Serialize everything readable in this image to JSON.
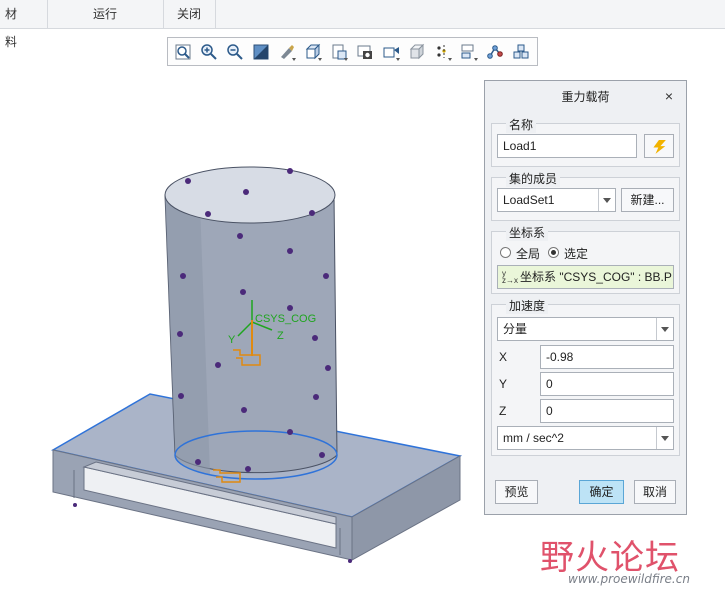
{
  "menubar": {
    "items": [
      {
        "label": "材料"
      },
      {
        "label": "运行"
      },
      {
        "label": "关闭"
      }
    ]
  },
  "toolbar": {
    "icons": [
      "zoom-fit-icon",
      "zoom-in-icon",
      "zoom-out-icon",
      "shade-style-icon",
      "repaint-icon",
      "saved-view-icon",
      "view-manager-icon",
      "display-style-icon",
      "spin-center-icon",
      "datum-display-icon",
      "annotation-display-icon",
      "layer-icon",
      "simulation-display-icon",
      "hide-icon"
    ]
  },
  "model": {
    "csys_label": "CSYS_COG",
    "axis_x": "Y",
    "axis_z": "Z"
  },
  "dialog": {
    "title": "重力载荷",
    "close": "×",
    "name_group": "名称",
    "name_value": "Load1",
    "set_group": "集的成员",
    "set_value": "LoadSet1",
    "new_button": "新建...",
    "csys_group": "坐标系",
    "radio_global": "全局",
    "radio_selected": "选定",
    "csys_value": "坐标系 \"CSYS_COG\" : BB.P",
    "accel_group": "加速度",
    "component_mode": "分量",
    "x_label": "X",
    "x_value": "-0.98",
    "y_label": "Y",
    "y_value": "0",
    "z_label": "Z",
    "z_value": "0",
    "units": "mm / sec^2",
    "preview_button": "预览",
    "ok_button": "确定",
    "cancel_button": "取消"
  },
  "watermark": {
    "cn": "野火论坛",
    "url": "www.proewildfire.cn"
  }
}
